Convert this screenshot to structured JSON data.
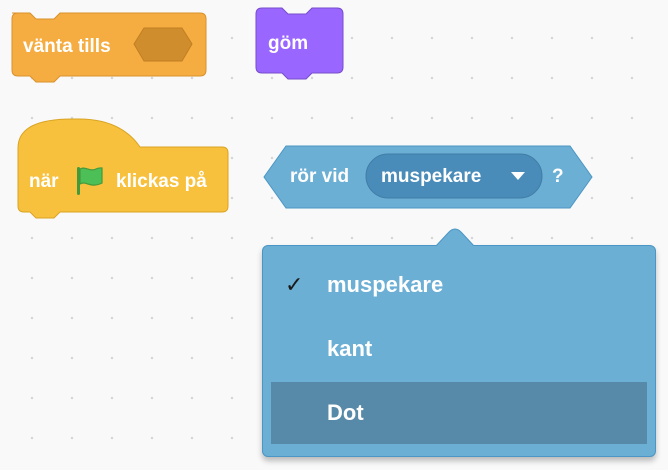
{
  "blocks": {
    "wait_until": {
      "label": "vänta tills",
      "color": "#f5ad42",
      "border": "#d9912c",
      "slot_color": "#cf8d2e"
    },
    "hide": {
      "label": "göm",
      "color": "#9966ff",
      "border": "#774dcb"
    },
    "when_flag": {
      "label_before": "när",
      "label_after": "klickas på",
      "color": "#f8c13d",
      "border": "#d9a424",
      "flag_icon": "green-flag-icon",
      "flag_color": "#4cbf56"
    },
    "touching": {
      "label": "rör vid",
      "value": "muspekare",
      "suffix": "?",
      "color": "#6cafd5",
      "border": "#4b96c4",
      "field_color": "#4a8cb9",
      "dropdown_icon": "triangle-down-icon"
    }
  },
  "dropdown": {
    "items": [
      {
        "label": "muspekare",
        "checked": true,
        "check_glyph": "✓"
      },
      {
        "label": "kant",
        "checked": false
      },
      {
        "label": "Dot",
        "checked": false,
        "highlighted": true
      }
    ],
    "background": "#6cafd5",
    "highlight": "#5789a9"
  }
}
